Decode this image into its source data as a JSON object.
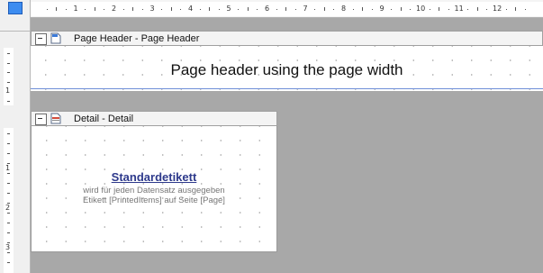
{
  "ruler": {
    "numbers": [
      "1",
      "2",
      "3",
      "4",
      "5",
      "6",
      "7",
      "8",
      "9",
      "10",
      "11",
      "12"
    ],
    "vertical_header_numbers": [
      "1"
    ],
    "vertical_detail_numbers": [
      "1",
      "2",
      "3"
    ]
  },
  "page_header": {
    "section_label": "Page Header - Page Header",
    "title_text": "Page header using the page width"
  },
  "detail": {
    "section_label": "Detail - Detail",
    "label_title": "Standardetikett",
    "line1": "wird für jeden Datensatz ausgegeben",
    "line2": "Etikett [PrintedItems] auf Seite [Page]"
  },
  "colors": {
    "accent": "#3c8cf0",
    "canvas": "#a8a8a8",
    "title_blue": "#2e3a8c",
    "separator": "#6f8fd8"
  },
  "icons": {
    "corner": "blue-square-icon",
    "page_header": "page-header-icon",
    "detail": "detail-section-icon",
    "collapse": "collapse-minus-icon"
  }
}
